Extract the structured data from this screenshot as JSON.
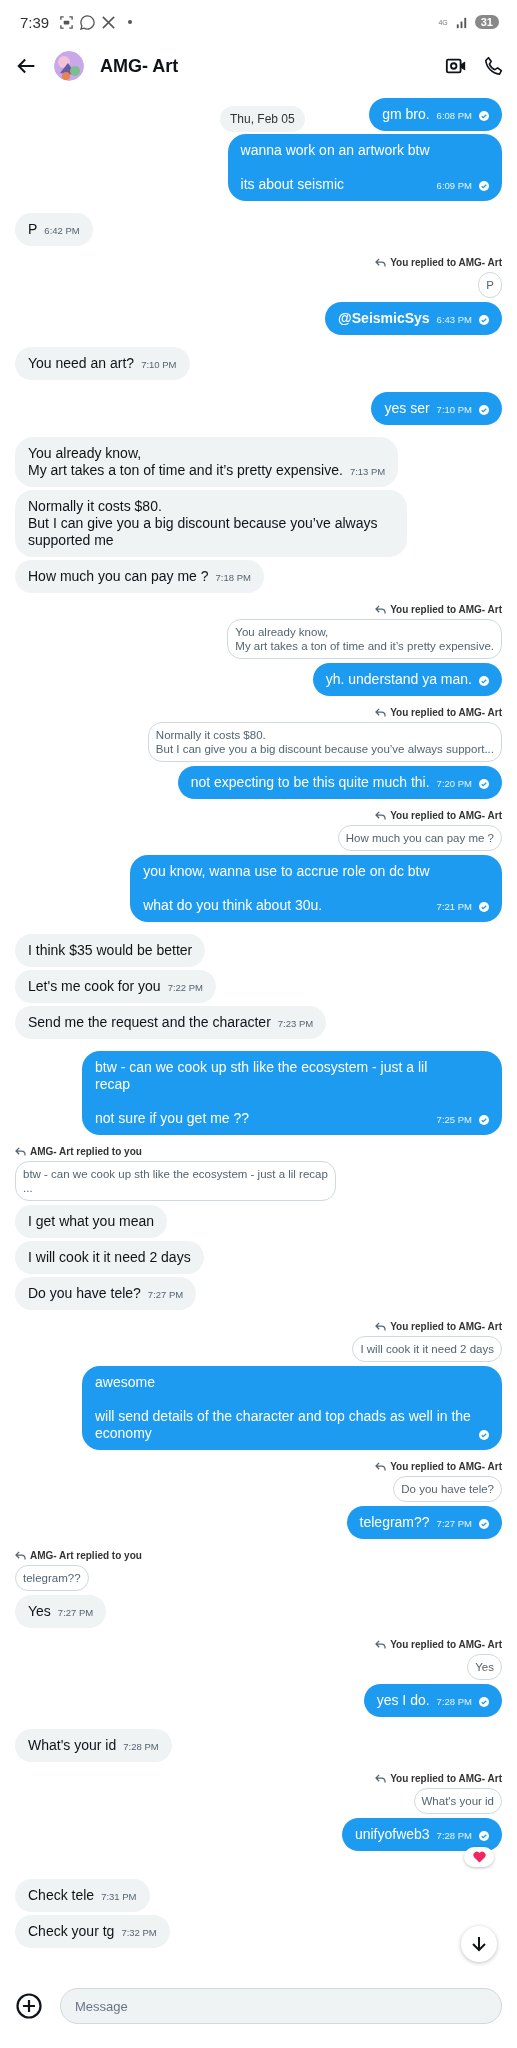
{
  "status_bar": {
    "time": "7:39",
    "network": "4G",
    "battery": "31"
  },
  "header": {
    "title": "AMG- Art"
  },
  "date_chip": "Thu, Feb 05",
  "messages": [
    {
      "kind": "sent",
      "text": "gm bro.",
      "time": "6:08 PM"
    },
    {
      "kind": "sent",
      "text": "wanna work on an artwork btw\n\nits about seismic",
      "time": "6:09 PM"
    },
    {
      "kind": "received",
      "text": "P",
      "time": "6:42 PM"
    },
    {
      "kind": "sent",
      "text": "@SeismicSys",
      "time": "6:43 PM",
      "bold": true,
      "reply": {
        "label": "You replied to AMG- Art",
        "quote": "P"
      }
    },
    {
      "kind": "received",
      "text": "You need an art?",
      "time": "7:10 PM"
    },
    {
      "kind": "sent",
      "text": "yes ser",
      "time": "7:10 PM"
    },
    {
      "kind": "received",
      "text": "You already know,\nMy art takes a ton of time and it’s pretty expensive.",
      "time": "7:13 PM"
    },
    {
      "kind": "received",
      "text": "Normally it costs $80.\nBut I can give you a big discount because you’ve always supported me"
    },
    {
      "kind": "received",
      "text": "How much you can pay me ?",
      "time": "7:18 PM"
    },
    {
      "kind": "sent",
      "text": "yh. understand ya man.",
      "reply": {
        "label": "You replied to AMG- Art",
        "quote": "You already know,\nMy art takes a ton of time and it’s pretty expensive."
      }
    },
    {
      "kind": "sent",
      "text": "not expecting to be this quite much thi.",
      "time": "7:20 PM",
      "reply": {
        "label": "You replied to AMG- Art",
        "quote": "Normally it costs $80.\nBut I can give you a big discount because you’ve always support..."
      }
    },
    {
      "kind": "sent",
      "text": "you know, wanna use to accrue role on dc btw\n\nwhat do you think about 30u.",
      "time": "7:21 PM",
      "reply": {
        "label": "You replied to AMG- Art",
        "quote": "How much you can pay me ?"
      }
    },
    {
      "kind": "received",
      "text": "I think $35 would be better"
    },
    {
      "kind": "received",
      "text": "Let's me cook for you",
      "time": "7:22 PM"
    },
    {
      "kind": "received",
      "text": "Send me the request and the character",
      "time": "7:23 PM"
    },
    {
      "kind": "sent",
      "text": "btw - can we cook up sth like the ecosystem - just a lil recap\n\nnot sure if you get me ??",
      "time": "7:25 PM"
    },
    {
      "kind": "received",
      "text": "I get what you mean",
      "reply": {
        "label": "AMG- Art replied to you",
        "quote": "btw - can we cook up sth like the ecosystem - just a lil recap\n..."
      }
    },
    {
      "kind": "received",
      "text": "I will cook it it need 2 days"
    },
    {
      "kind": "received",
      "text": "Do you have tele?",
      "time": "7:27 PM"
    },
    {
      "kind": "sent",
      "text": "awesome\n\nwill send details of the character and top chads as well in the economy",
      "reply": {
        "label": "You replied to AMG- Art",
        "quote": "I will cook it it need 2 days"
      }
    },
    {
      "kind": "sent",
      "text": "telegram??",
      "time": "7:27 PM",
      "reply": {
        "label": "You replied to AMG- Art",
        "quote": "Do you have tele?"
      }
    },
    {
      "kind": "received",
      "text": "Yes",
      "time": "7:27 PM",
      "reply": {
        "label": "AMG- Art replied to you",
        "quote": "telegram??"
      }
    },
    {
      "kind": "sent",
      "text": "yes I do.",
      "time": "7:28 PM",
      "reply": {
        "label": "You replied to AMG- Art",
        "quote": "Yes"
      }
    },
    {
      "kind": "received",
      "text": "What's your id",
      "time": "7:28 PM"
    },
    {
      "kind": "sent",
      "text": "unifyofweb3",
      "time": "7:28 PM",
      "reacted": true,
      "reply": {
        "label": "You replied to AMG- Art",
        "quote": "What's your id"
      }
    },
    {
      "kind": "received",
      "text": "Check tele",
      "time": "7:31 PM"
    },
    {
      "kind": "received",
      "text": "Check your tg",
      "time": "7:32 PM"
    }
  ],
  "composer": {
    "placeholder": "Message"
  }
}
